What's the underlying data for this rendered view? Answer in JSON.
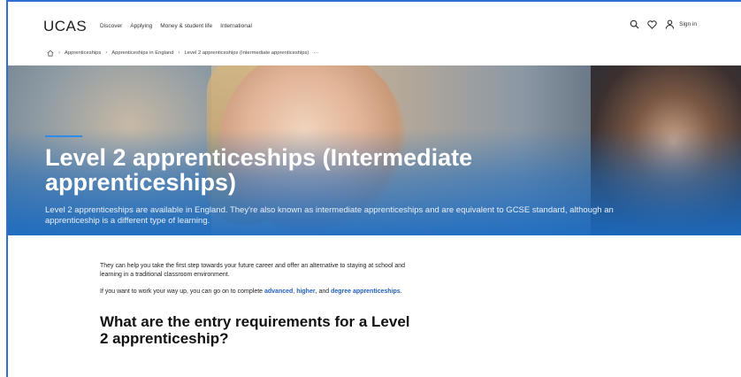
{
  "header": {
    "logo": "UCAS",
    "nav": [
      "Discover",
      "Applying",
      "Money & student life",
      "International"
    ],
    "signin": "Sign in"
  },
  "breadcrumb": {
    "items": [
      "Apprenticeships",
      "Apprenticeships in England",
      "Level 2 apprenticeships (Intermediate apprenticeships)"
    ],
    "more": "···"
  },
  "hero": {
    "title": "Level 2 apprenticeships (Intermediate apprenticeships)",
    "subtitle": "Level 2 apprenticeships are available in England. They're also known as intermediate apprenticeships and are equivalent to GCSE standard, although an apprenticeship is a different type of learning."
  },
  "content": {
    "para1": "They can help you take the first step towards your future career and offer an alternative to staying at school and learning in a traditional classroom environment.",
    "para2_prefix": "If you want to work your way up, you can go on to complete ",
    "link_advanced": "advanced",
    "sep1": ", ",
    "link_higher": "higher",
    "sep2": ", and ",
    "link_degree": "degree apprenticeships",
    "para2_suffix": ".",
    "heading": "What are the entry requirements for a Level 2 apprenticeship?"
  },
  "icons": {
    "home": "home-icon",
    "search": "search-icon",
    "favourite": "heart-icon",
    "account": "user-icon"
  },
  "colors": {
    "accent": "#2f8be6",
    "link": "#1f5fbf",
    "hero_overlay": "#1a6cc4",
    "frame": "#2f6fcf"
  }
}
